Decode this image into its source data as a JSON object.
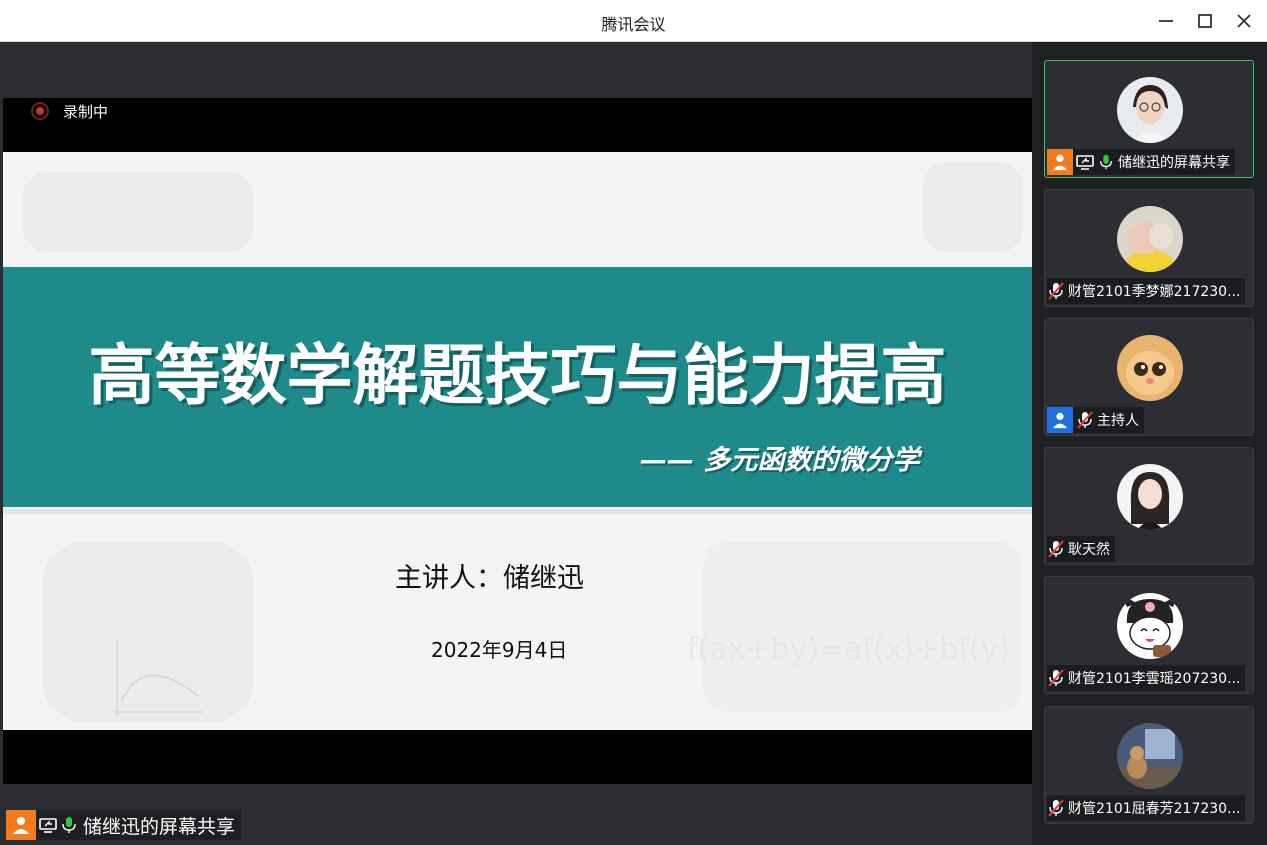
{
  "window": {
    "title": "腾讯会议"
  },
  "recording": {
    "label": "录制中"
  },
  "slide": {
    "title": "高等数学解题技巧与能力提高",
    "subtitle": "—— 多元函数的微分学",
    "presenter": "主讲人：储继迅",
    "date": "2022年9月4日",
    "formula": "f(ax+by)=af(x)+bf(y)"
  },
  "share": {
    "sharer_label": "储继迅的屏幕共享"
  },
  "participants": [
    {
      "name": "储继迅的屏幕共享",
      "role": "sharer",
      "mic": "on",
      "screen_share": true,
      "avatar": "woman-glasses-avatar"
    },
    {
      "name": "财管2101季梦娜217230...",
      "role": "member",
      "mic": "muted",
      "avatar": "plush-toy-avatar"
    },
    {
      "name": "主持人",
      "role": "host",
      "mic": "muted",
      "avatar": "cat-avatar"
    },
    {
      "name": "耿天然",
      "role": "member",
      "mic": "muted",
      "avatar": "anime-girl-avatar"
    },
    {
      "name": "财管2101李雲瑶207230...",
      "role": "member",
      "mic": "muted",
      "avatar": "kuromi-avatar"
    },
    {
      "name": "财管2101屈春芳217230...",
      "role": "member",
      "mic": "muted",
      "avatar": "room-scene-avatar"
    }
  ],
  "colors": {
    "accent": "#1f8a8a",
    "active_border": "#3dbf6a",
    "sharer_orange": "#f07c1e",
    "host_blue": "#1e6fe0",
    "mic_green": "#2ecc40"
  }
}
